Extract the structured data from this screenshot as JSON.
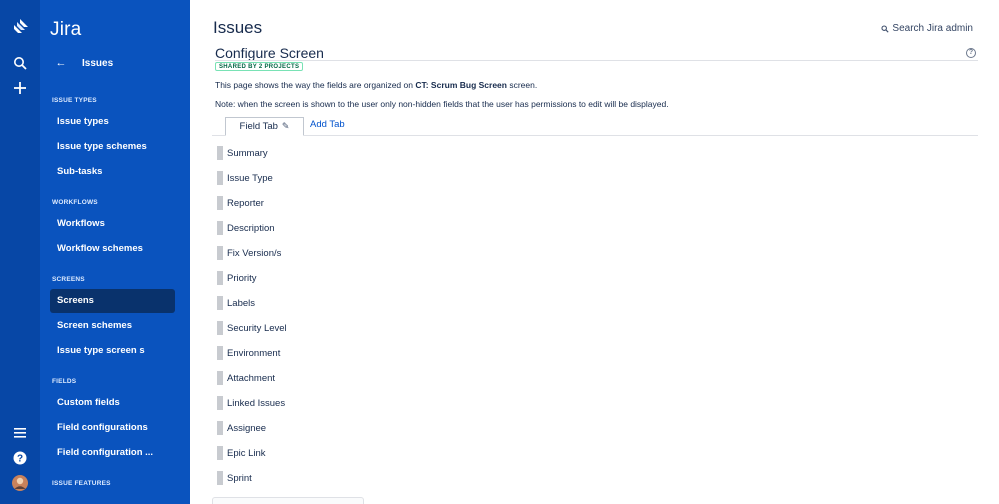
{
  "colors": {
    "rail_bg": "#0747a6",
    "sidebar_bg": "#0a53be",
    "sidebar_selected_bg": "#09326c",
    "link": "#0052cc",
    "badge_text": "#006644",
    "badge_border": "#79e2b5"
  },
  "rail": {
    "icons": [
      "jira-logo-icon",
      "search-icon",
      "create-icon",
      "menu-icon",
      "help-icon",
      "avatar"
    ]
  },
  "sidebar": {
    "product_name": "Jira",
    "back_label": "Issues",
    "sections": [
      {
        "title": "ISSUE TYPES",
        "items": [
          "Issue types",
          "Issue type schemes",
          "Sub-tasks"
        ]
      },
      {
        "title": "WORKFLOWS",
        "items": [
          "Workflows",
          "Workflow schemes"
        ]
      },
      {
        "title": "SCREENS",
        "items": [
          "Screens",
          "Screen schemes",
          "Issue type screen s"
        ]
      },
      {
        "title": "FIELDS",
        "items": [
          "Custom fields",
          "Field configurations",
          "Field configuration ..."
        ]
      },
      {
        "title": "ISSUE FEATURES",
        "items": []
      }
    ],
    "selected_item": "Screens"
  },
  "header": {
    "title": "Issues",
    "search_label": "Search Jira admin"
  },
  "screen": {
    "title": "Configure Screen",
    "badge": "SHARED BY 2 PROJECTS",
    "desc_prefix": "This page shows the way the fields are organized on ",
    "desc_bold": "CT: Scrum Bug Screen",
    "desc_suffix": " screen.",
    "note": "Note: when the screen is shown to the user only non-hidden fields that the user has permissions to edit will be displayed."
  },
  "tabs": {
    "active_label": "Field Tab",
    "add_label": "Add Tab"
  },
  "fields": [
    "Summary",
    "Issue Type",
    "Reporter",
    "Description",
    "Fix Version/s",
    "Priority",
    "Labels",
    "Security Level",
    "Environment",
    "Attachment",
    "Linked Issues",
    "Assignee",
    "Epic Link",
    "Sprint"
  ]
}
